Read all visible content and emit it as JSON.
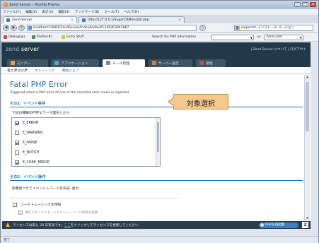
{
  "window": {
    "title": "Zend Server - Mozilla Firefox",
    "buttons": [
      "_",
      "□",
      "×"
    ]
  },
  "menubar": [
    "ファイル(F)",
    "編集(E)",
    "表示(V)",
    "履歴(S)",
    "ブックマーク(B)",
    "ツール(T)",
    "ヘルプ(H)"
  ],
  "browser_tabs": [
    {
      "label": "Zend Server",
      "active": true
    },
    {
      "label": "http://127.0.0.1/SugarCRM/install.php",
      "active": false
    }
  ],
  "navbar": {
    "url": "localhost:10081/ZendServer/Index/Index#1349363042887",
    "search_value": "sugarcrm インストール バージョン"
  },
  "toolbar2": {
    "debug_label": "Debug(@)",
    "profile_label": "Profile(#)",
    "extra_label": "Extra Stuff",
    "search_php_label": "Search for PHP information",
    "on_label": "on",
    "domain_value": "Zend.com"
  },
  "app": {
    "brand_a": "zend",
    "brand_b": " server",
    "header_links": "| Zend Server について | ログアウト",
    "tabs": [
      {
        "label": "モニター",
        "color": "#f0a030",
        "active": false
      },
      {
        "label": "アプリケーション",
        "color": "#5aa0d8",
        "active": false
      },
      {
        "label": "ルール管理",
        "color": "#6c8aa6",
        "active": true
      },
      {
        "label": "サーバー設定",
        "color": "#e07a3a",
        "active": false
      },
      {
        "label": "管理",
        "color": "#c0504d",
        "active": false
      }
    ],
    "subnav": [
      {
        "label": "モニタリング",
        "active": true
      },
      {
        "label": "キャッシング",
        "active": false
      },
      {
        "label": "期限ジョブ",
        "active": false
      }
    ],
    "page_title": "Fatal PHP Error",
    "description": "Triggered when a PHP error of one of the selected error levels is reported",
    "section1_title": "その1：イベント条件",
    "condition_label": "下記の種類のPHPエラーが発生したら",
    "error_levels": [
      {
        "label": "E_ERROR",
        "checked": true
      },
      {
        "label": "E_WARNING",
        "checked": false
      },
      {
        "label": "E_PARSE",
        "checked": true
      },
      {
        "label": "E_NOTICE",
        "checked": false
      },
      {
        "label": "E_CORE_ERROR",
        "checked": true
      }
    ],
    "callout_text": "対象選択",
    "section2_title": "その2：イベント操作",
    "severity_line": "影響度つきでイベントレコードを作成: 重大",
    "code_tracing_label": "コードトレーシングを保管",
    "sub_option_label": "現在スカンバイモードならトレーシング保管を起動",
    "status_message_prefix": "ライセンスは再と 28 日有効です。",
    "status_link": "ここ",
    "status_message_suffix": "をクリックしてライセンスを更新してください",
    "restart_button": "PHPを再起動",
    "zend_mark": "Z"
  },
  "firefox_status": "完了"
}
